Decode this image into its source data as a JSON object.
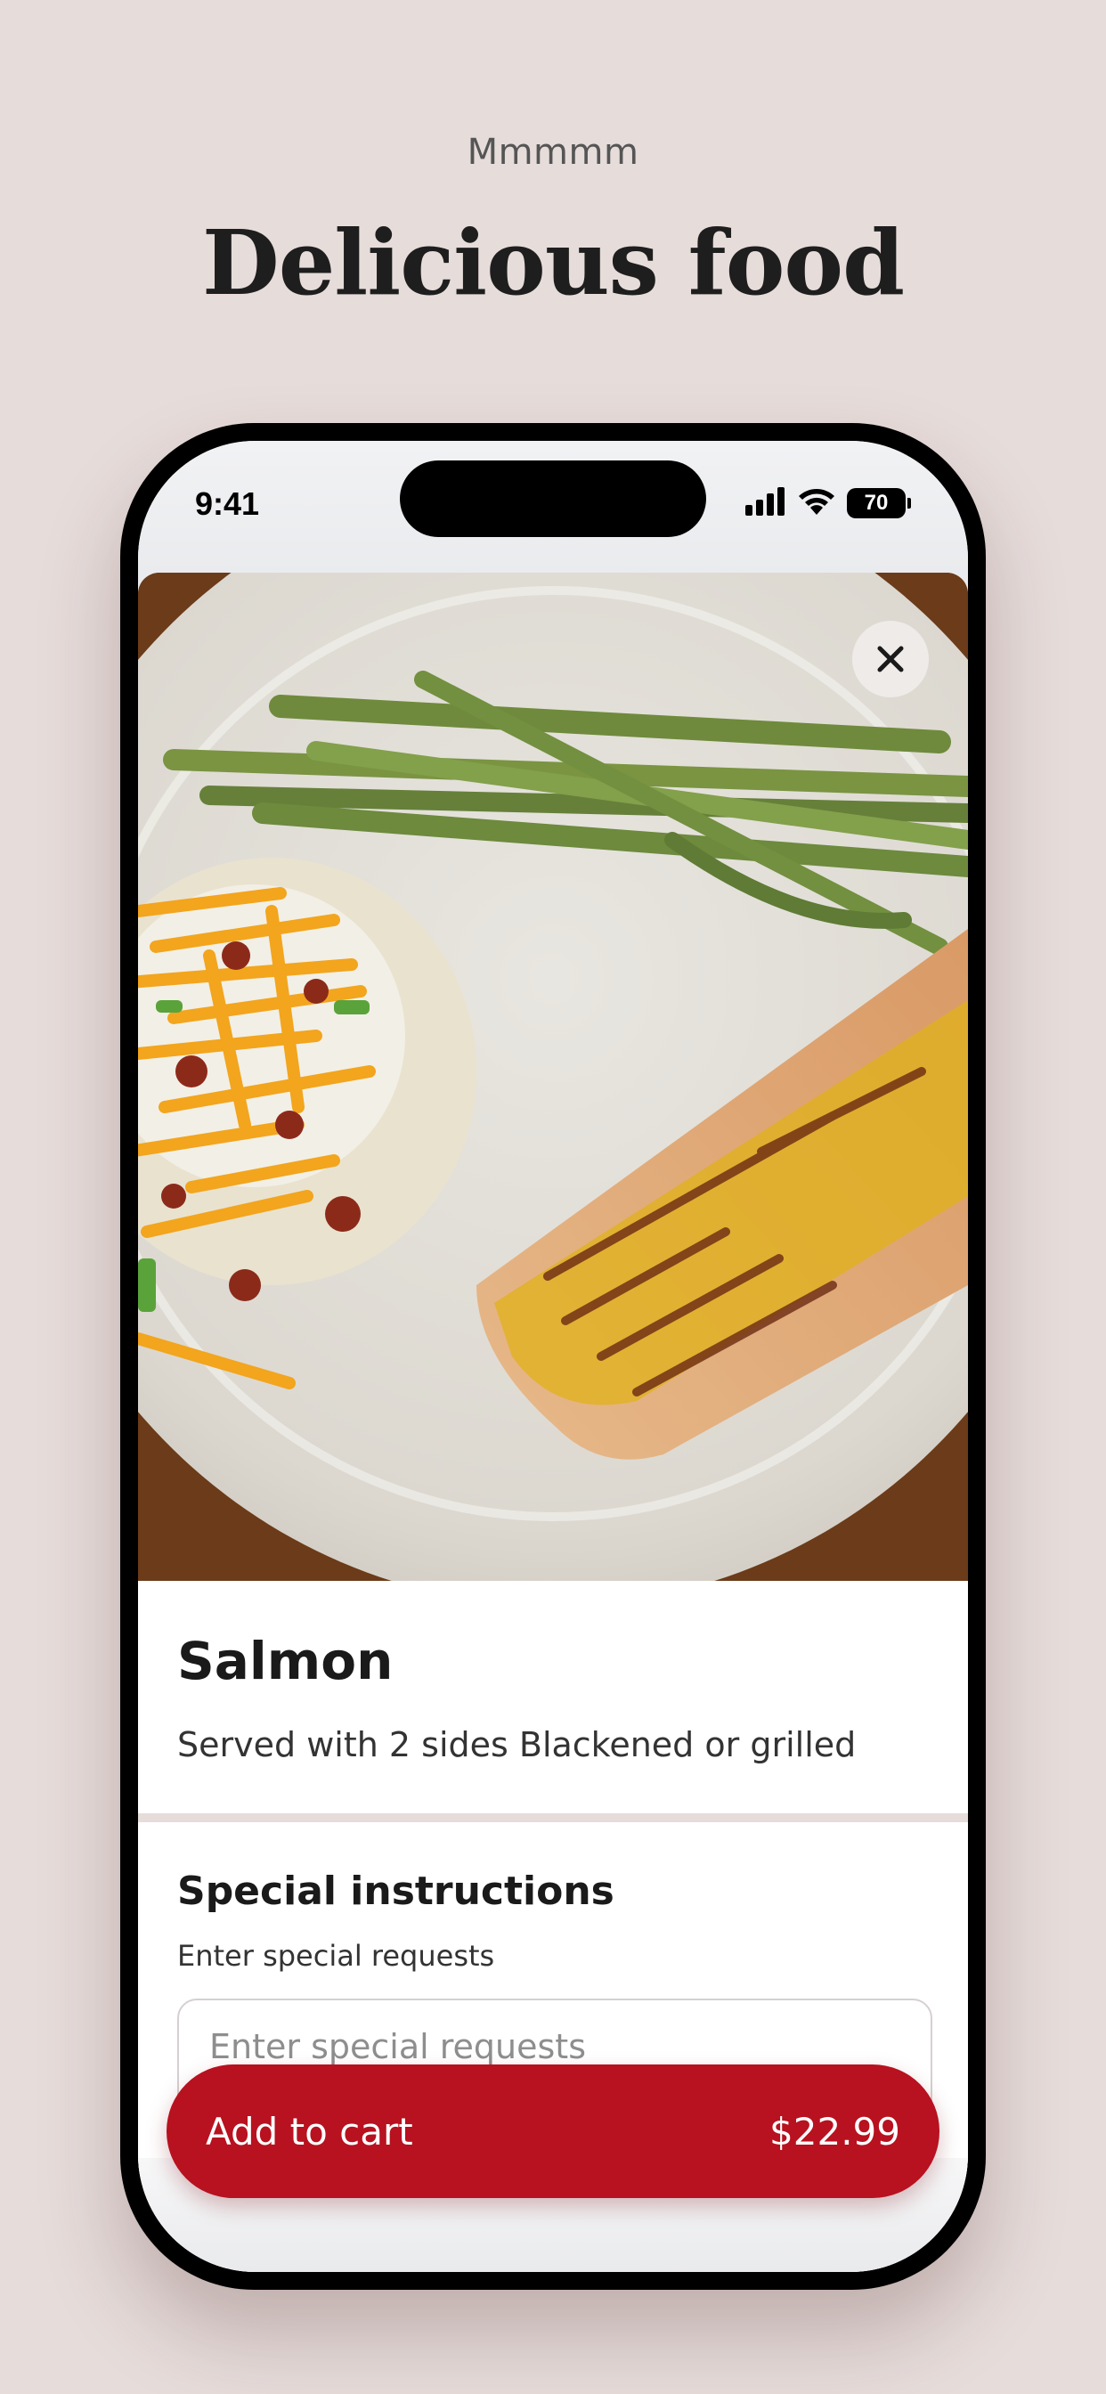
{
  "hero": {
    "eyebrow": "Mmmmm",
    "headline": "Delicious food"
  },
  "status_bar": {
    "time": "9:41",
    "battery_level": "70",
    "icons": [
      "cellular-signal-icon",
      "wifi-icon",
      "battery-icon"
    ]
  },
  "item": {
    "image_icon": "food-photo",
    "name": "Salmon",
    "description": "Served with 2 sides Blackened or grilled"
  },
  "special_instructions": {
    "title": "Special instructions",
    "subtitle": "Enter special requests",
    "placeholder": "Enter special requests",
    "value": ""
  },
  "actions": {
    "close_icon": "close-icon",
    "add_to_cart_label": "Add to cart",
    "price": "$22.99"
  },
  "colors": {
    "background": "#e6dcda",
    "accent": "#b8111f",
    "text": "#1a1a1a"
  }
}
